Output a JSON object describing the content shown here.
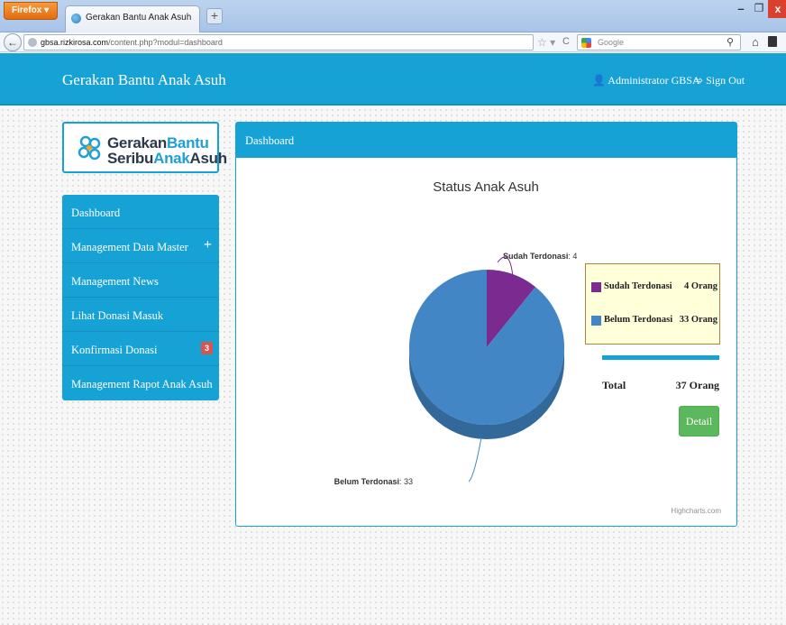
{
  "browser": {
    "app_button": "Firefox",
    "tab_title": "Gerakan Bantu Anak Asuh",
    "new_tab": "+",
    "url_domain": "gbsa.rizkirosa.com",
    "url_path": "/content.php?modul=dashboard",
    "search_placeholder": "Google"
  },
  "header": {
    "title": "Gerakan Bantu Anak Asuh",
    "user": "Administrator GBSA",
    "signout": "Sign Out"
  },
  "logo": {
    "part1": "Gerakan",
    "part2": "Bantu",
    "part3": "Seribu",
    "part4": "Anak",
    "part5": "Asuh"
  },
  "sidebar": {
    "items": [
      {
        "label": "Dashboard"
      },
      {
        "label": "Management Data Master",
        "expand": "+"
      },
      {
        "label": "Management News"
      },
      {
        "label": "Lihat Donasi Masuk"
      },
      {
        "label": "Konfirmasi Donasi",
        "badge": "3"
      },
      {
        "label": "Management Rapot Anak Asuh"
      }
    ]
  },
  "panel": {
    "heading": "Dashboard"
  },
  "chart_data": {
    "type": "pie",
    "title": "Status Anak Asuh",
    "slices": [
      {
        "name": "Sudah Terdonasi",
        "value": 4,
        "color": "#7b2a90"
      },
      {
        "name": "Belum Terdonasi",
        "value": 33,
        "color": "#4286c6"
      }
    ],
    "credits": "Highcharts.com"
  },
  "legend": {
    "rows": [
      {
        "name": "Sudah Terdonasi",
        "value": "4 Orang",
        "color": "#7b2a90"
      },
      {
        "name": "Belum Terdonasi",
        "value": "33 Orang",
        "color": "#4286c6"
      }
    ]
  },
  "summary": {
    "total_label": "Total",
    "total_value": "37 Orang",
    "detail_button": "Detail"
  },
  "colors": {
    "primary": "#17a2d6",
    "success": "#5cb85c",
    "badge": "#d9534f"
  }
}
